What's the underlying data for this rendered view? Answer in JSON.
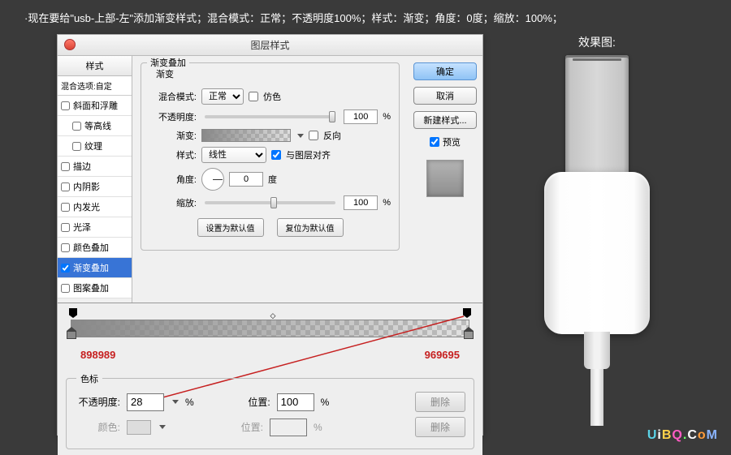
{
  "caption": "·现在要给\"usb-上部-左\"添加渐变样式；混合模式：正常；不透明度100%；样式：渐变；角度：0度；缩放：100%；",
  "dialog": {
    "title": "图层样式",
    "styles_header": "样式",
    "blend_option": "混合选项:自定",
    "items": [
      "斜面和浮雕",
      "等高线",
      "纹理",
      "描边",
      "内阴影",
      "内发光",
      "光泽",
      "颜色叠加",
      "渐变叠加",
      "图案叠加"
    ],
    "selected_index": 8
  },
  "overlay": {
    "group_label": "渐变叠加",
    "subgroup_label": "渐变",
    "blend_label": "混合模式:",
    "blend_value": "正常",
    "dither_label": "仿色",
    "opacity_label": "不透明度:",
    "opacity_value": "100",
    "percent": "%",
    "gradient_label": "渐变:",
    "reverse_label": "反向",
    "style_label": "样式:",
    "style_value": "线性",
    "align_label": "与图层对齐",
    "angle_label": "角度:",
    "angle_value": "0",
    "degree": "度",
    "scale_label": "缩放:",
    "scale_value": "100",
    "set_default": "设置为默认值",
    "reset_default": "复位为默认值"
  },
  "buttons": {
    "ok": "确定",
    "cancel": "取消",
    "new_style": "新建样式...",
    "preview": "预览"
  },
  "gradient": {
    "left_hex": "898989",
    "right_hex": "969695",
    "stops_group": "色标",
    "opacity_label": "不透明度:",
    "opacity_value": "28",
    "position_label": "位置:",
    "position_value": "100",
    "delete": "删除",
    "color_label": "颜色:",
    "percent": "%"
  },
  "preview_label": "效果图:",
  "watermark": "UiBQ.CoM"
}
